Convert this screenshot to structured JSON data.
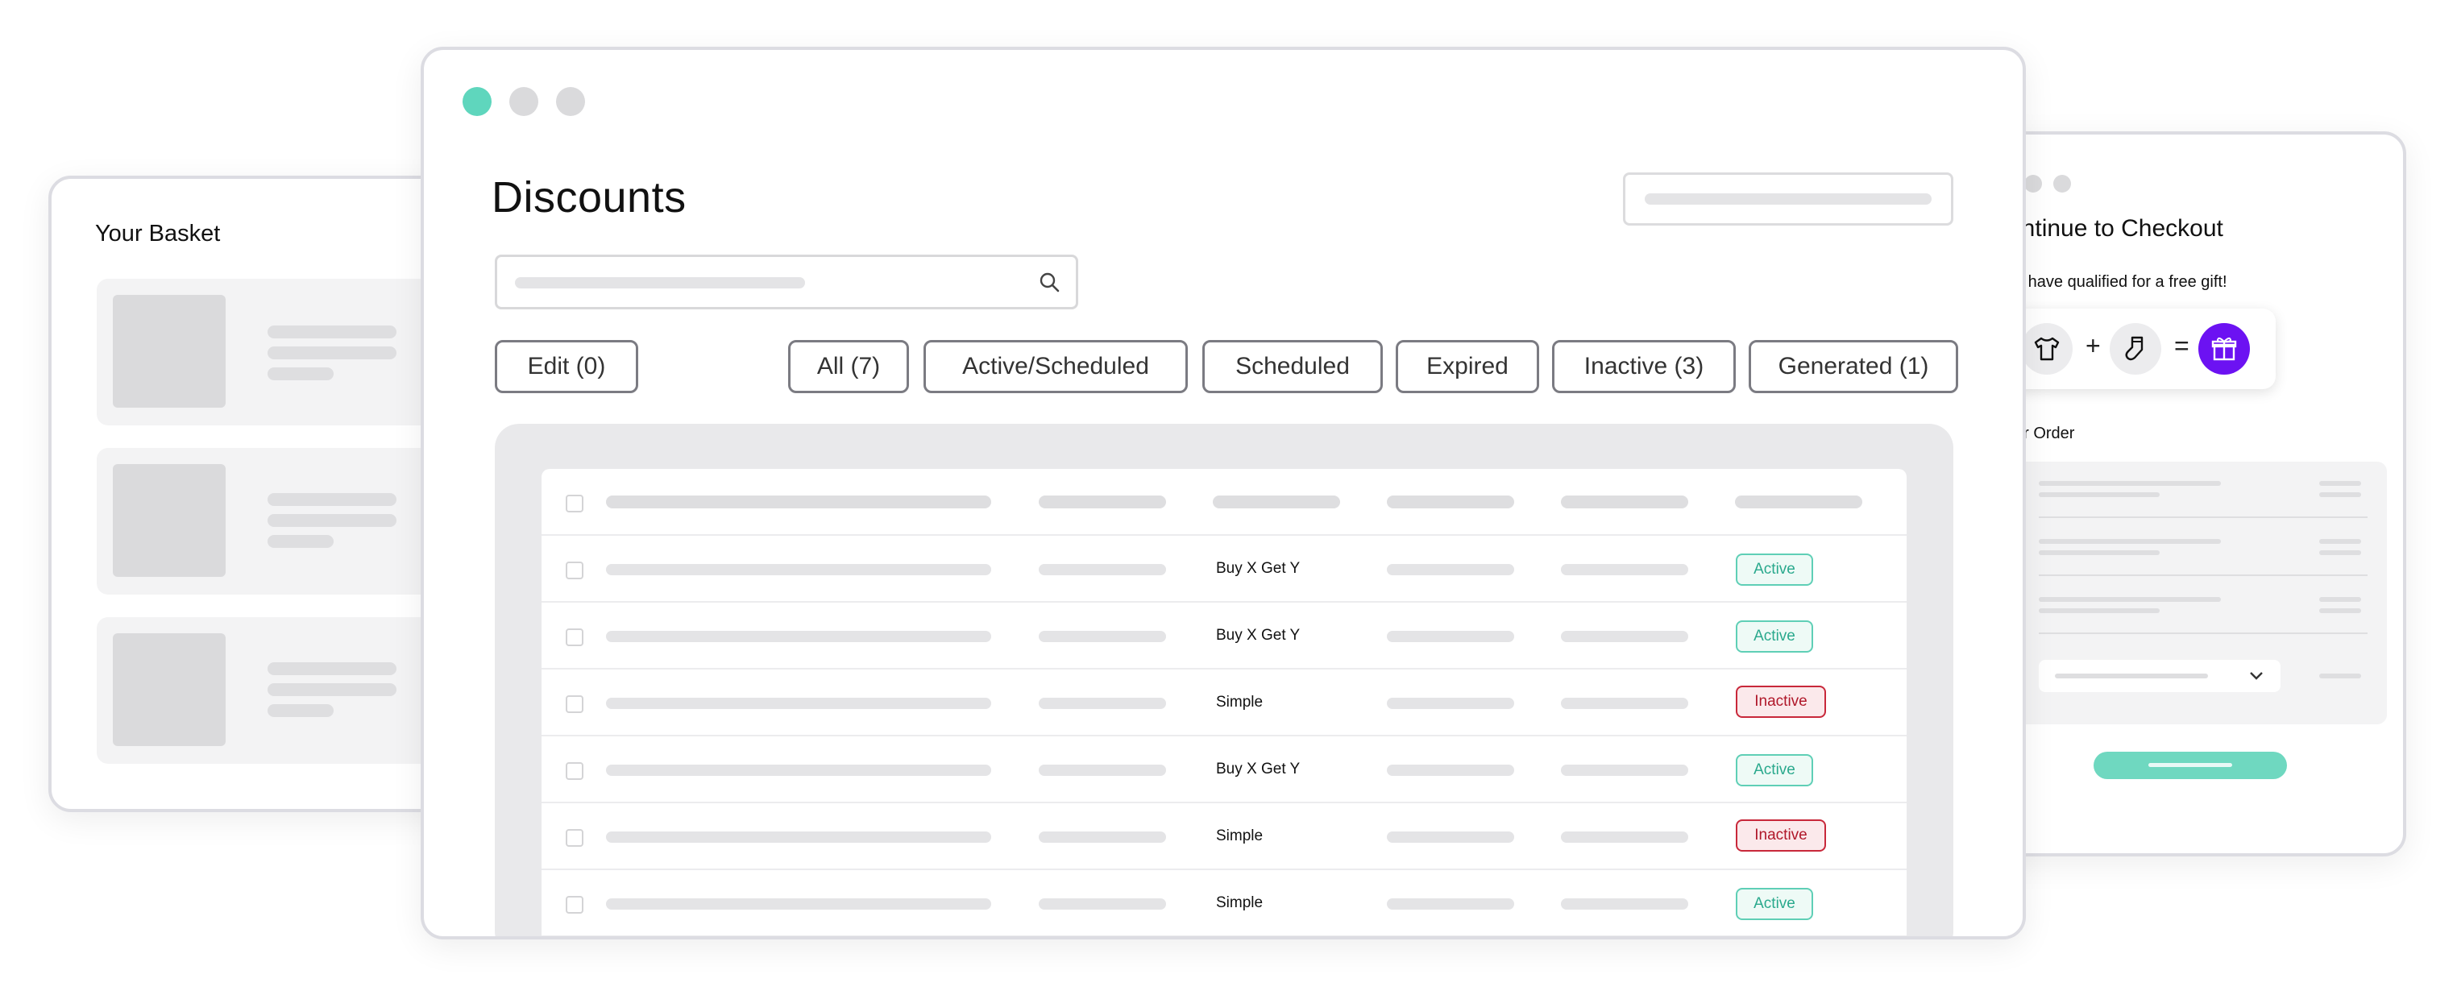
{
  "basket": {
    "title": "Your Basket",
    "item_count": 3
  },
  "checkout": {
    "title": "ontinue to Checkout",
    "subtitle": "u have qualified for a free gift!",
    "order_label": "ur Order",
    "icons": [
      "tshirt-icon",
      "sock-icon",
      "gift-icon"
    ],
    "plus": "+",
    "equals": "=",
    "accent": "#6c12f2",
    "button_color": "#6fd8c0"
  },
  "main": {
    "title": "Discounts",
    "traffic_lights": [
      "#5fd6bd",
      "#dadadc",
      "#dadadc"
    ],
    "edit_button": "Edit (0)",
    "filters": [
      "All (7)",
      "Active/Scheduled",
      "Scheduled",
      "Expired",
      "Inactive (3)",
      "Generated (1)"
    ],
    "rows": [
      {
        "type": "Buy X Get Y",
        "status": "Active"
      },
      {
        "type": "Buy X Get Y",
        "status": "Active"
      },
      {
        "type": "Simple",
        "status": "Inactive"
      },
      {
        "type": "Buy X Get Y",
        "status": "Active"
      },
      {
        "type": "Simple",
        "status": "Inactive"
      },
      {
        "type": "Simple",
        "status": "Active"
      }
    ],
    "colors": {
      "active": "#2aa98d",
      "inactive": "#b0182a"
    }
  }
}
